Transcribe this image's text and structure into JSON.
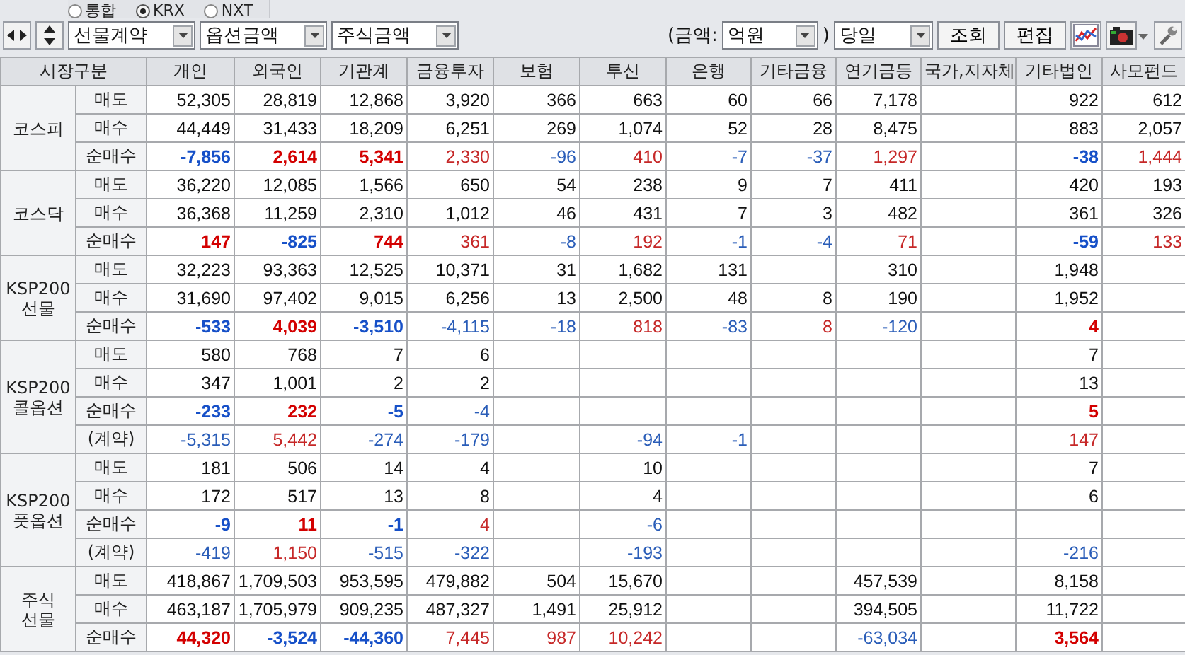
{
  "market_radios": [
    {
      "label": "통합",
      "selected": false
    },
    {
      "label": "KRX",
      "selected": true
    },
    {
      "label": "NXT",
      "selected": false
    }
  ],
  "toolbar": {
    "dropdowns": [
      "선물계약",
      "옵션금액",
      "주식금액"
    ],
    "amount_open": "(금액:",
    "unit": "억원",
    "amount_close": ")",
    "period": "당일",
    "buttons": [
      "조회",
      "편집"
    ]
  },
  "table": {
    "columns": [
      "시장구분",
      "개인",
      "외국인",
      "기관계",
      "금융투자",
      "보험",
      "투신",
      "은행",
      "기타금융",
      "연기금등",
      "국가,지자체",
      "기타법인",
      "사모펀드"
    ],
    "groups": [
      {
        "label_lines": [
          "코스피"
        ],
        "rows": [
          {
            "label": "매도",
            "kind": "plain",
            "cells": [
              "52,305",
              "28,819",
              "12,868",
              "3,920",
              "366",
              "663",
              "60",
              "66",
              "7,178",
              null,
              "922",
              "612"
            ]
          },
          {
            "label": "매수",
            "kind": "plain",
            "cells": [
              "44,449",
              "31,433",
              "18,209",
              "6,251",
              "269",
              "1,074",
              "52",
              "28",
              "8,475",
              null,
              "883",
              "2,057"
            ]
          },
          {
            "label": "순매수",
            "kind": "signed",
            "cells": [
              {
                "v": "-7,856",
                "up": false,
                "bold": true
              },
              {
                "v": "2,614",
                "up": true,
                "bold": true
              },
              {
                "v": "5,341",
                "up": true,
                "bold": true
              },
              {
                "v": "2,330",
                "up": true,
                "bold": false
              },
              {
                "v": "-96",
                "up": false,
                "bold": false
              },
              {
                "v": "410",
                "up": true,
                "bold": false
              },
              {
                "v": "-7",
                "up": false,
                "bold": false
              },
              {
                "v": "-37",
                "up": false,
                "bold": false
              },
              {
                "v": "1,297",
                "up": true,
                "bold": false
              },
              null,
              {
                "v": "-38",
                "up": false,
                "bold": true
              },
              {
                "v": "1,444",
                "up": true,
                "bold": false
              }
            ]
          }
        ]
      },
      {
        "label_lines": [
          "코스닥"
        ],
        "rows": [
          {
            "label": "매도",
            "kind": "plain",
            "cells": [
              "36,220",
              "12,085",
              "1,566",
              "650",
              "54",
              "238",
              "9",
              "7",
              "411",
              null,
              "420",
              "193"
            ]
          },
          {
            "label": "매수",
            "kind": "plain",
            "cells": [
              "36,368",
              "11,259",
              "2,310",
              "1,012",
              "46",
              "431",
              "7",
              "3",
              "482",
              null,
              "361",
              "326"
            ]
          },
          {
            "label": "순매수",
            "kind": "signed",
            "cells": [
              {
                "v": "147",
                "up": true,
                "bold": true
              },
              {
                "v": "-825",
                "up": false,
                "bold": true
              },
              {
                "v": "744",
                "up": true,
                "bold": true
              },
              {
                "v": "361",
                "up": true,
                "bold": false
              },
              {
                "v": "-8",
                "up": false,
                "bold": false
              },
              {
                "v": "192",
                "up": true,
                "bold": false
              },
              {
                "v": "-1",
                "up": false,
                "bold": false
              },
              {
                "v": "-4",
                "up": false,
                "bold": false
              },
              {
                "v": "71",
                "up": true,
                "bold": false
              },
              null,
              {
                "v": "-59",
                "up": false,
                "bold": true
              },
              {
                "v": "133",
                "up": true,
                "bold": false
              }
            ]
          }
        ]
      },
      {
        "label_lines": [
          "KSP200",
          "선물"
        ],
        "rows": [
          {
            "label": "매도",
            "kind": "plain",
            "cells": [
              "32,223",
              "93,363",
              "12,525",
              "10,371",
              "31",
              "1,682",
              "131",
              null,
              "310",
              null,
              "1,948",
              null
            ]
          },
          {
            "label": "매수",
            "kind": "plain",
            "cells": [
              "31,690",
              "97,402",
              "9,015",
              "6,256",
              "13",
              "2,500",
              "48",
              "8",
              "190",
              null,
              "1,952",
              null
            ]
          },
          {
            "label": "순매수",
            "kind": "signed",
            "cells": [
              {
                "v": "-533",
                "up": false,
                "bold": true
              },
              {
                "v": "4,039",
                "up": true,
                "bold": true
              },
              {
                "v": "-3,510",
                "up": false,
                "bold": true
              },
              {
                "v": "-4,115",
                "up": false,
                "bold": false
              },
              {
                "v": "-18",
                "up": false,
                "bold": false
              },
              {
                "v": "818",
                "up": true,
                "bold": false
              },
              {
                "v": "-83",
                "up": false,
                "bold": false
              },
              {
                "v": "8",
                "up": true,
                "bold": false
              },
              {
                "v": "-120",
                "up": false,
                "bold": false
              },
              null,
              {
                "v": "4",
                "up": true,
                "bold": true
              },
              null
            ]
          }
        ]
      },
      {
        "label_lines": [
          "KSP200",
          "콜옵션"
        ],
        "rows": [
          {
            "label": "매도",
            "kind": "plain",
            "cells": [
              "580",
              "768",
              "7",
              "6",
              null,
              null,
              null,
              null,
              null,
              null,
              "7",
              null
            ]
          },
          {
            "label": "매수",
            "kind": "plain",
            "cells": [
              "347",
              "1,001",
              "2",
              "2",
              null,
              null,
              null,
              null,
              null,
              null,
              "13",
              null
            ]
          },
          {
            "label": "순매수",
            "kind": "signed",
            "cells": [
              {
                "v": "-233",
                "up": false,
                "bold": true
              },
              {
                "v": "232",
                "up": true,
                "bold": true
              },
              {
                "v": "-5",
                "up": false,
                "bold": true
              },
              {
                "v": "-4",
                "up": false,
                "bold": false
              },
              null,
              null,
              null,
              null,
              null,
              null,
              {
                "v": "5",
                "up": true,
                "bold": true
              },
              null
            ]
          },
          {
            "label": "(계약)",
            "kind": "signed",
            "cells": [
              {
                "v": "-5,315",
                "up": false,
                "bold": false
              },
              {
                "v": "5,442",
                "up": true,
                "bold": false
              },
              {
                "v": "-274",
                "up": false,
                "bold": false
              },
              {
                "v": "-179",
                "up": false,
                "bold": false
              },
              null,
              {
                "v": "-94",
                "up": false,
                "bold": false
              },
              {
                "v": "-1",
                "up": false,
                "bold": false
              },
              null,
              null,
              null,
              {
                "v": "147",
                "up": true,
                "bold": false
              },
              null
            ]
          }
        ]
      },
      {
        "label_lines": [
          "KSP200",
          "풋옵션"
        ],
        "rows": [
          {
            "label": "매도",
            "kind": "plain",
            "cells": [
              "181",
              "506",
              "14",
              "4",
              null,
              "10",
              null,
              null,
              null,
              null,
              "7",
              null
            ]
          },
          {
            "label": "매수",
            "kind": "plain",
            "cells": [
              "172",
              "517",
              "13",
              "8",
              null,
              "4",
              null,
              null,
              null,
              null,
              "6",
              null
            ]
          },
          {
            "label": "순매수",
            "kind": "signed",
            "cells": [
              {
                "v": "-9",
                "up": false,
                "bold": true
              },
              {
                "v": "11",
                "up": true,
                "bold": true
              },
              {
                "v": "-1",
                "up": false,
                "bold": true
              },
              {
                "v": "4",
                "up": true,
                "bold": false
              },
              null,
              {
                "v": "-6",
                "up": false,
                "bold": false
              },
              null,
              null,
              null,
              null,
              null,
              null
            ]
          },
          {
            "label": "(계약)",
            "kind": "signed",
            "cells": [
              {
                "v": "-419",
                "up": false,
                "bold": false
              },
              {
                "v": "1,150",
                "up": true,
                "bold": false
              },
              {
                "v": "-515",
                "up": false,
                "bold": false
              },
              {
                "v": "-322",
                "up": false,
                "bold": false
              },
              null,
              {
                "v": "-193",
                "up": false,
                "bold": false
              },
              null,
              null,
              null,
              null,
              {
                "v": "-216",
                "up": false,
                "bold": false
              },
              null
            ]
          }
        ]
      },
      {
        "label_lines": [
          "주식",
          "선물"
        ],
        "rows": [
          {
            "label": "매도",
            "kind": "plain",
            "cells": [
              "418,867",
              "1,709,503",
              "953,595",
              "479,882",
              "504",
              "15,670",
              null,
              null,
              "457,539",
              null,
              "8,158",
              null
            ]
          },
          {
            "label": "매수",
            "kind": "plain",
            "cells": [
              "463,187",
              "1,705,979",
              "909,235",
              "487,327",
              "1,491",
              "25,912",
              null,
              null,
              "394,505",
              null,
              "11,722",
              null
            ]
          },
          {
            "label": "순매수",
            "kind": "signed",
            "cells": [
              {
                "v": "44,320",
                "up": true,
                "bold": true
              },
              {
                "v": "-3,524",
                "up": false,
                "bold": true
              },
              {
                "v": "-44,360",
                "up": false,
                "bold": true
              },
              {
                "v": "7,445",
                "up": true,
                "bold": false
              },
              {
                "v": "987",
                "up": true,
                "bold": false
              },
              {
                "v": "10,242",
                "up": true,
                "bold": false
              },
              null,
              null,
              {
                "v": "-63,034",
                "up": false,
                "bold": false
              },
              null,
              {
                "v": "3,564",
                "up": true,
                "bold": true
              },
              null
            ]
          }
        ]
      }
    ]
  }
}
